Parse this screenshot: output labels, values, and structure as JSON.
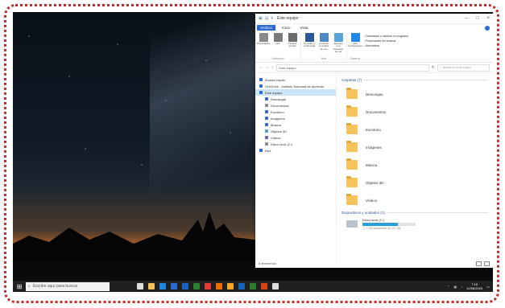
{
  "window": {
    "title": "Este equipo",
    "controls": [
      "–",
      "□",
      "×"
    ],
    "tabs": [
      {
        "label": "Archivo",
        "active": true
      },
      {
        "label": "Inicio",
        "active": false
      },
      {
        "label": "Vista",
        "active": false
      }
    ]
  },
  "ribbon": {
    "groups": [
      {
        "name": "Ubicación",
        "buttons": [
          {
            "label": "Propiedades",
            "icon": "check-properties-icon",
            "color": "#8a8a8a"
          },
          {
            "label": "Abrir",
            "icon": "open-icon",
            "color": "#7a7a7a"
          },
          {
            "label": "Cambiar nombre",
            "icon": "rename-icon",
            "color": "#6b6b6b"
          }
        ]
      },
      {
        "name": "Red",
        "buttons": [
          {
            "label": "Acceder a multimedia",
            "icon": "media-icon",
            "color": "#2b5797"
          },
          {
            "label": "Conectar a unidad de red",
            "icon": "network-drive-icon",
            "color": "#4a8ac9"
          },
          {
            "label": "Agregar una ubicación de red",
            "icon": "network-location-icon",
            "color": "#59a5d8"
          }
        ]
      },
      {
        "name": "Sistema",
        "buttons": [
          {
            "label": "Abrir Configuración",
            "icon": "settings-icon",
            "color": "#1e88e5"
          }
        ]
      }
    ],
    "system_items": [
      "Desinstalar o cambiar un programa",
      "Propiedades del sistema",
      "Administrar"
    ]
  },
  "address": {
    "path": "Este equipo",
    "search_placeholder": "Buscar en Este equipo"
  },
  "nav": [
    {
      "label": "Acceso rápido",
      "icon": "star-icon",
      "color": "#2b6bd1",
      "sub": false,
      "selected": false
    },
    {
      "label": "OneDrive - Instituto Nacional de Aprendiz",
      "icon": "cloud-icon",
      "color": "#2b6bd1",
      "sub": false,
      "selected": false
    },
    {
      "label": "Este equipo",
      "icon": "computer-icon",
      "color": "#2b6bd1",
      "sub": false,
      "selected": true
    },
    {
      "label": "Descargas",
      "icon": "download-icon",
      "color": "#2b6bd1",
      "sub": true,
      "selected": false
    },
    {
      "label": "Documentos",
      "icon": "documents-icon",
      "color": "#8a8a8a",
      "sub": true,
      "selected": false
    },
    {
      "label": "Escritorio",
      "icon": "desktop-icon",
      "color": "#2b6bd1",
      "sub": true,
      "selected": false
    },
    {
      "label": "Imágenes",
      "icon": "pictures-icon",
      "color": "#2b6bd1",
      "sub": true,
      "selected": false
    },
    {
      "label": "Música",
      "icon": "music-icon",
      "color": "#2b6bd1",
      "sub": true,
      "selected": false
    },
    {
      "label": "Objetos 3D",
      "icon": "3d-objects-icon",
      "color": "#4aa3df",
      "sub": true,
      "selected": false
    },
    {
      "label": "Vídeos",
      "icon": "videos-icon",
      "color": "#7a5cc7",
      "sub": true,
      "selected": false
    },
    {
      "label": "Disco local (C:)",
      "icon": "drive-icon",
      "color": "#8a8a8a",
      "sub": true,
      "selected": false
    },
    {
      "label": "Red",
      "icon": "network-icon",
      "color": "#2b6bd1",
      "sub": false,
      "selected": false
    }
  ],
  "content": {
    "folders_header": "Carpetas (7)",
    "folders": [
      {
        "label": "Descargas",
        "icon": "download-folder-icon"
      },
      {
        "label": "Documentos",
        "icon": "documents-folder-icon"
      },
      {
        "label": "Escritorio",
        "icon": "desktop-folder-icon"
      },
      {
        "label": "Imágenes",
        "icon": "pictures-folder-icon"
      },
      {
        "label": "Música",
        "icon": "music-folder-icon"
      },
      {
        "label": "Objetos 3D",
        "icon": "3d-folder-icon"
      },
      {
        "label": "Vídeos",
        "icon": "videos-folder-icon"
      }
    ],
    "drives_header": "Dispositivos y unidades (1)",
    "drive": {
      "name": "Disco local (C:)",
      "free": "77,7 GB disponibles de 237 GB",
      "used_fraction": 0.67
    }
  },
  "status": {
    "items": "8 elementos"
  },
  "taskbar": {
    "search_placeholder": "Escribe aquí para buscar",
    "apps": [
      {
        "icon": "task-view-icon",
        "color": "#dddddd"
      },
      {
        "icon": "file-explorer-icon",
        "color": "#f4c35a"
      },
      {
        "icon": "edge-icon",
        "color": "#1e88e5"
      },
      {
        "icon": "store-icon",
        "color": "#2b6bd1"
      },
      {
        "icon": "mail-icon",
        "color": "#1565c0"
      },
      {
        "icon": "photos-icon",
        "color": "#2e7d32"
      },
      {
        "icon": "chrome-icon",
        "color": "#e53935"
      },
      {
        "icon": "firefox-icon",
        "color": "#ef6c00"
      },
      {
        "icon": "vlc-icon",
        "color": "#f9a825"
      },
      {
        "icon": "word-icon",
        "color": "#1565c0"
      },
      {
        "icon": "excel-icon",
        "color": "#2e7d32"
      },
      {
        "icon": "powerpoint-icon",
        "color": "#d84315"
      },
      {
        "icon": "settings-icon",
        "color": "#dddddd"
      }
    ],
    "time": "7:16",
    "date": "12/06/2023"
  }
}
